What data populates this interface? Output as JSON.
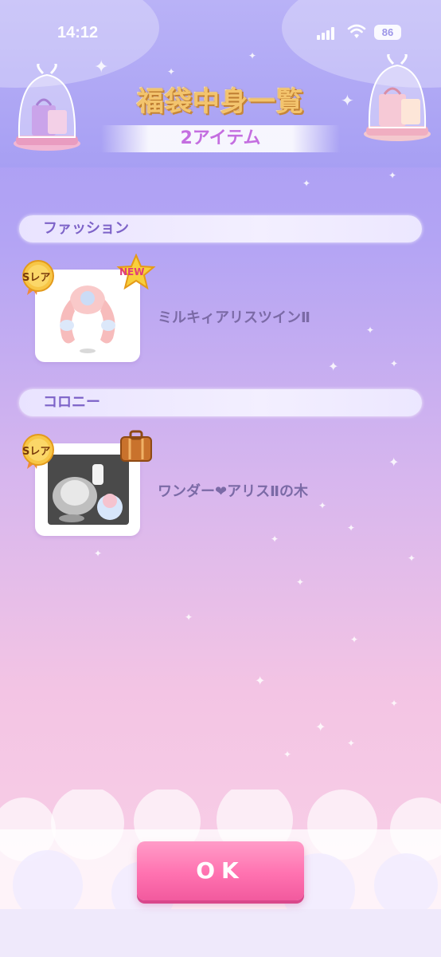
{
  "status_bar": {
    "time": "14:12",
    "battery": "86"
  },
  "header": {
    "title": "福袋中身一覧",
    "item_count": "2アイテム"
  },
  "sections": [
    {
      "label": "ファッション",
      "items": [
        {
          "name": "ミルキィアリスツインⅡ",
          "rarity_badge": "Sレア",
          "extra_badge": "NEW",
          "icon": "twin-tail-hair-icon"
        }
      ]
    },
    {
      "label": "コロニー",
      "items": [
        {
          "name": "ワンダー❤アリスⅡの木",
          "rarity_badge": "Sレア",
          "extra_badge_icon": "suitcase-icon",
          "icon": "wonder-alice-tree-icon"
        }
      ]
    }
  ],
  "footer": {
    "ok_label": "OK"
  },
  "colors": {
    "accent_pink": "#ff72b0",
    "title_gold": "#f3c46d",
    "section_text": "#7d63c8",
    "item_text": "#7b6aa6"
  }
}
